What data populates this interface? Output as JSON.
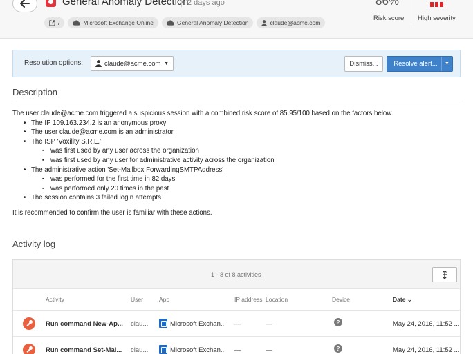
{
  "header": {
    "back_icon": "arrow-left-icon",
    "alert_icon": "anomaly-icon",
    "title": "General Anomaly Detection",
    "time_ago": "2 days ago",
    "pills": [
      {
        "icon": "external-link-icon",
        "label": "/"
      },
      {
        "icon": "cloud-icon",
        "label": "Microsoft Exchange Online"
      },
      {
        "icon": "cloud-icon",
        "label": "General Anomaly Detection"
      },
      {
        "icon": "user-icon",
        "label": "claude@acme.com"
      }
    ],
    "risk_score": "86%",
    "risk_score_label": "Risk score",
    "severity_label": "High severity",
    "severity_color": "#d9272e"
  },
  "resolution": {
    "label": "Resolution options:",
    "user": "claude@acme.com",
    "dismiss_label": "Dismiss...",
    "resolve_label": "Resolve alert...",
    "accent": "#3f82c9"
  },
  "description": {
    "title": "Description",
    "intro": "The user claude@acme.com triggered a suspicious session with a combined risk score of 85.95/100 based on the factors below.",
    "items": [
      {
        "level": 1,
        "text": "The IP 109.163.234.2 is an anonymous proxy"
      },
      {
        "level": 1,
        "text": "The user claude@acme.com is an administrator"
      },
      {
        "level": 1,
        "text": "The ISP 'Voxility S.R.L.'"
      },
      {
        "level": 2,
        "text": "was first used by any user across the organization"
      },
      {
        "level": 2,
        "text": "was first used by any user for administrative activity across the organization"
      },
      {
        "level": 1,
        "text": "The administrative action 'Set-Mailbox ForwardingSMTPAddress'"
      },
      {
        "level": 2,
        "text": "was performed for the first time in 82 days"
      },
      {
        "level": 2,
        "text": "was performed only 20 times in the past"
      },
      {
        "level": 1,
        "text": "The session contains 3 failed login attempts"
      }
    ],
    "recommendation": "It is recommended to confirm the user is familiar with these actions."
  },
  "activity_log": {
    "title": "Activity log",
    "count": "1 - 8 of 8 activities",
    "columns": {
      "activity": "Activity",
      "user": "User",
      "app": "App",
      "ip": "IP address",
      "location": "Location",
      "device": "Device",
      "date": "Date"
    },
    "rows": [
      {
        "activity": "Run command New-Ap...",
        "user": "clau...",
        "app": "Microsoft Exchan...",
        "ip": "—",
        "location": "—",
        "device": "?",
        "date": "May 24, 2016, 11:52 ..."
      },
      {
        "activity": "Run command Set-Mai...",
        "user": "clau...",
        "app": "Microsoft Exchan...",
        "ip": "—",
        "location": "—",
        "device": "?",
        "date": "May 24, 2016, 11:52 ..."
      }
    ]
  }
}
